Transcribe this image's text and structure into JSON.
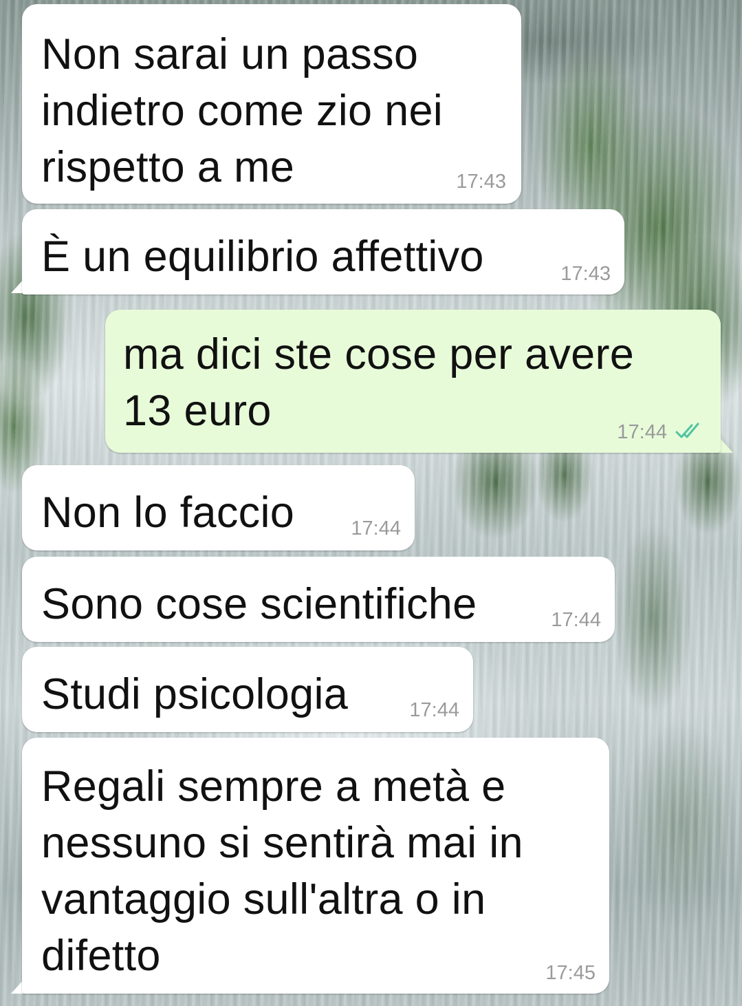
{
  "colors": {
    "incoming_bubble": "#ffffff",
    "outgoing_bubble": "#e7fbd9",
    "timestamp": "#9a9a9a",
    "read_ticks": "#4fc3a0"
  },
  "messages": [
    {
      "direction": "incoming",
      "text": "Non sarai un passo\nindietro come zio nei\nrispetto a me",
      "time": "17:43"
    },
    {
      "direction": "incoming",
      "text": "È un equilibrio affettivo",
      "time": "17:43"
    },
    {
      "direction": "outgoing",
      "text": "ma dici ste cose per avere\n13 euro",
      "time": "17:44",
      "status_icon": "double-check-read-icon"
    },
    {
      "direction": "incoming",
      "text": "Non lo faccio",
      "time": "17:44"
    },
    {
      "direction": "incoming",
      "text": "Sono cose scientifiche",
      "time": "17:44"
    },
    {
      "direction": "incoming",
      "text": "Studi psicologia",
      "time": "17:44"
    },
    {
      "direction": "incoming",
      "text": "Regali sempre a metà e\nnessuno si sentirà mai in\nvantaggio sull'altra o in\ndifetto",
      "time": "17:45"
    }
  ]
}
